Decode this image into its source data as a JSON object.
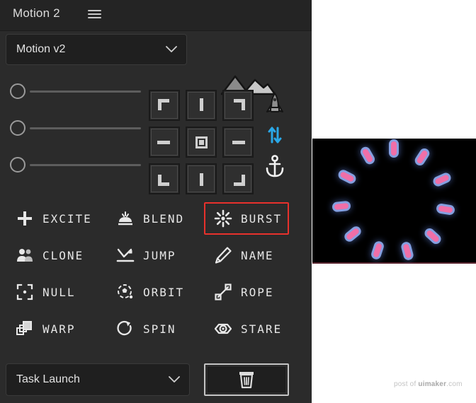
{
  "panel": {
    "title": "Motion 2",
    "menu_icon": "hamburger-menu-icon"
  },
  "preset": {
    "value": "Motion v2",
    "chevron_icon": "chevron-down-icon",
    "image_icon": "mountain-image-icon"
  },
  "sliders": [
    {
      "name": "slider-1",
      "value": 0
    },
    {
      "name": "slider-2",
      "value": 0
    },
    {
      "name": "slider-3",
      "value": 0
    }
  ],
  "anchor_grid": {
    "name": "anchor-alignment-grid",
    "cells": [
      {
        "name": "anchor-top-left",
        "glyph": "corner-top-left"
      },
      {
        "name": "anchor-top-center",
        "glyph": "bar-vertical"
      },
      {
        "name": "anchor-top-right",
        "glyph": "corner-top-right"
      },
      {
        "name": "anchor-middle-left",
        "glyph": "bar-horizontal"
      },
      {
        "name": "anchor-center",
        "glyph": "square-center"
      },
      {
        "name": "anchor-middle-right",
        "glyph": "bar-horizontal"
      },
      {
        "name": "anchor-bottom-left",
        "glyph": "corner-bottom-left"
      },
      {
        "name": "anchor-bottom-center",
        "glyph": "bar-vertical"
      },
      {
        "name": "anchor-bottom-right",
        "glyph": "corner-bottom-right"
      }
    ]
  },
  "side_tools": [
    {
      "name": "rocket-icon",
      "color": "#8f8f8f"
    },
    {
      "name": "arrows-vertical-icon",
      "color": "#2aa8e8"
    },
    {
      "name": "anchor-icon",
      "color": "#f2f2f2"
    }
  ],
  "actions": [
    {
      "label": "EXCITE",
      "icon": "plus-icon",
      "selected": false
    },
    {
      "label": "BLEND",
      "icon": "blend-icon",
      "selected": false
    },
    {
      "label": "BURST",
      "icon": "burst-icon",
      "selected": true
    },
    {
      "label": "CLONE",
      "icon": "clone-icon",
      "selected": false
    },
    {
      "label": "JUMP",
      "icon": "jump-icon",
      "selected": false
    },
    {
      "label": "NAME",
      "icon": "pencil-icon",
      "selected": false
    },
    {
      "label": "NULL",
      "icon": "null-icon",
      "selected": false
    },
    {
      "label": "ORBIT",
      "icon": "orbit-icon",
      "selected": false
    },
    {
      "label": "ROPE",
      "icon": "rope-icon",
      "selected": false
    },
    {
      "label": "WARP",
      "icon": "warp-icon",
      "selected": false
    },
    {
      "label": "SPIN",
      "icon": "spin-icon",
      "selected": false
    },
    {
      "label": "STARE",
      "icon": "eye-icon",
      "selected": false
    }
  ],
  "bottom": {
    "task_select_value": "Task Launch",
    "task_chevron_icon": "chevron-down-icon",
    "trash_icon": "trash-icon"
  },
  "preview": {
    "name": "burst-animation-preview",
    "background": "#000000",
    "particle_color": "#f06fa8",
    "particle_glow_color": "#96b4fa",
    "particle_count": 11,
    "particles": [
      {
        "angle": -90,
        "radius": 74
      },
      {
        "angle": -57,
        "radius": 74
      },
      {
        "angle": -24,
        "radius": 74
      },
      {
        "angle": 9,
        "radius": 74
      },
      {
        "angle": 42,
        "radius": 74
      },
      {
        "angle": 75,
        "radius": 74
      },
      {
        "angle": 108,
        "radius": 74
      },
      {
        "angle": 141,
        "radius": 74
      },
      {
        "angle": 174,
        "radius": 74
      },
      {
        "angle": 207,
        "radius": 74
      },
      {
        "angle": 240,
        "radius": 74
      }
    ]
  },
  "watermark": {
    "prefix": "post of ",
    "brand": "uimaker",
    "suffix": ".com"
  },
  "colors": {
    "panel_bg": "#2b2b2b",
    "header_bg": "#242424",
    "field_bg": "#1f1f1f",
    "text": "#e6e6e6",
    "accent_selected": "#e8312c",
    "accent_blue": "#2aa8e8"
  }
}
